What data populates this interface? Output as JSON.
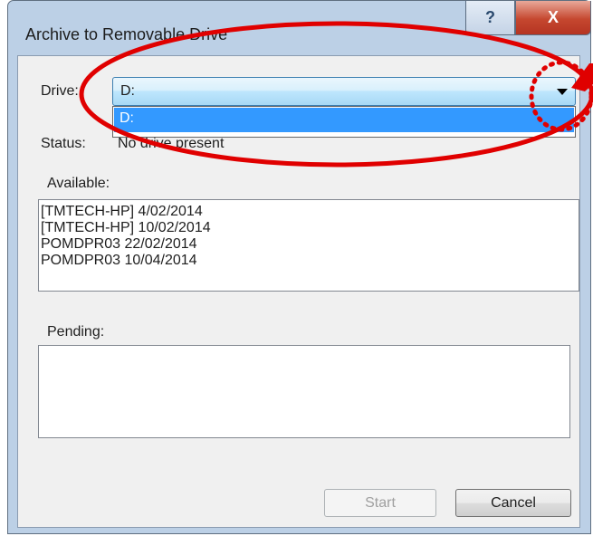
{
  "window": {
    "title": "Archive to Removable Drive",
    "help_label": "?",
    "close_label": "X"
  },
  "drive": {
    "label": "Drive:",
    "selected": "D:",
    "options": [
      "D:"
    ]
  },
  "status": {
    "label": "Status:",
    "value": "No drive present"
  },
  "available": {
    "label": "Available:",
    "items": [
      "[TMTECH-HP] 4/02/2014",
      "[TMTECH-HP] 10/02/2014",
      "POMDPR03 22/02/2014",
      "POMDPR03 10/04/2014"
    ]
  },
  "pending": {
    "label": "Pending:",
    "items": []
  },
  "buttons": {
    "start": "Start",
    "cancel": "Cancel"
  },
  "colors": {
    "highlight": "#3399ff",
    "annotation": "#e00000",
    "close_button": "#c5472f"
  }
}
